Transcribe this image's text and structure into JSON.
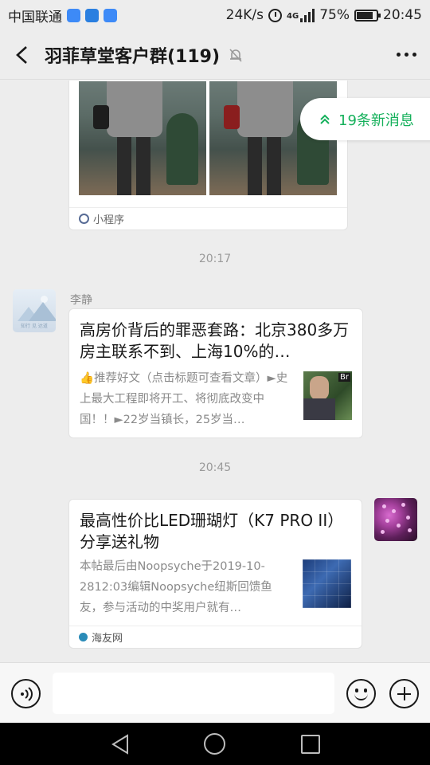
{
  "status_bar": {
    "carrier": "中国联通",
    "net_speed": "24K/s",
    "network_type": "4G",
    "battery": "75%",
    "battery_level": 0.75,
    "time": "20:45"
  },
  "header": {
    "title": "羽菲草堂客户群(119)"
  },
  "new_messages": {
    "label": "19条新消息"
  },
  "messages": {
    "mini_program": {
      "source_label": "小程序"
    },
    "time_1": "20:17",
    "article_1": {
      "sender": "李静",
      "avatar_caption": "知行 见 达道",
      "title": "高房价背后的罪恶套路：北京380多万房主联系不到、上海10%的…",
      "desc": "👍推荐好文（点击标题可查看文章）►史上最大工程即将开工、将彻底改变中国！！►22岁当镇长，25岁当…",
      "thumb_badge": "Br"
    },
    "time_2": "20:45",
    "article_2": {
      "title": "最高性价比LED珊瑚灯（K7 PRO II）分享送礼物",
      "desc": "本帖最后由Noopsyche于2019-10-2812:03编辑Noopsyche纽斯回馈鱼友，参与活动的中奖用户就有…",
      "source_label": "海友网"
    }
  },
  "input_bar": {
    "placeholder": ""
  },
  "colors": {
    "accent_green": "#15b05b",
    "background": "#ededed",
    "link_blue": "#576b95"
  }
}
